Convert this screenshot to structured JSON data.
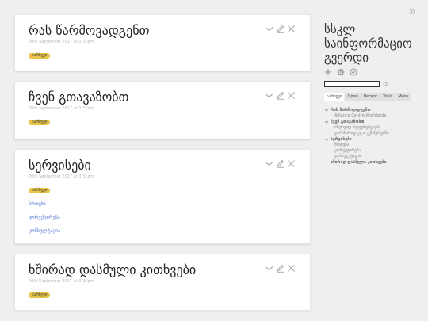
{
  "tiddlers": [
    {
      "title": "რას წარმოვადგენთ",
      "subtitle": "20th September 2017 at 3:32pm",
      "tag": "სარჩევი"
    },
    {
      "title": "ჩვენ გთავაზობთ",
      "subtitle": "20th September 2017 at 3:32pm",
      "tag": "სარჩევი"
    },
    {
      "title": "სერვისები",
      "subtitle": "20th September 2017 at 3:31pm",
      "tag": "სარჩევი",
      "links": [
        "წრთვნა",
        "კორექტირება",
        "კონსულტაცია"
      ]
    },
    {
      "title": "ხშირად დასმული კითხვები",
      "subtitle": "20th September 2017 at 3:35pm",
      "tag": "სარჩევი"
    }
  ],
  "sidebar": {
    "title": "სსკლ საინფორმაციო გვერდი",
    "search_placeholder": "",
    "tabs": [
      "სარჩევი",
      "Open",
      "Recent",
      "Tools",
      "More"
    ],
    "toc": {
      "item1": "რას წარმოვადგენთ",
      "item1_sub1": "Alliance Centre Worldwide",
      "item2": "ჩვენ გთავაზობთ",
      "item2_sub1": "ინდივიდ რეფერენციები",
      "item2_sub2": "კორპორაციული ექსპერტიზა",
      "item3": "სერვისები",
      "item3_sub1": "წრთვნა",
      "item3_sub2": "კორექტირება",
      "item3_sub3": "კონსულტაცია",
      "item4": "ხშირად დასმული კითხვები"
    }
  },
  "colors": {
    "tag": "#e6c549",
    "link": "#5778d8",
    "icon": "#aaaaaa"
  }
}
